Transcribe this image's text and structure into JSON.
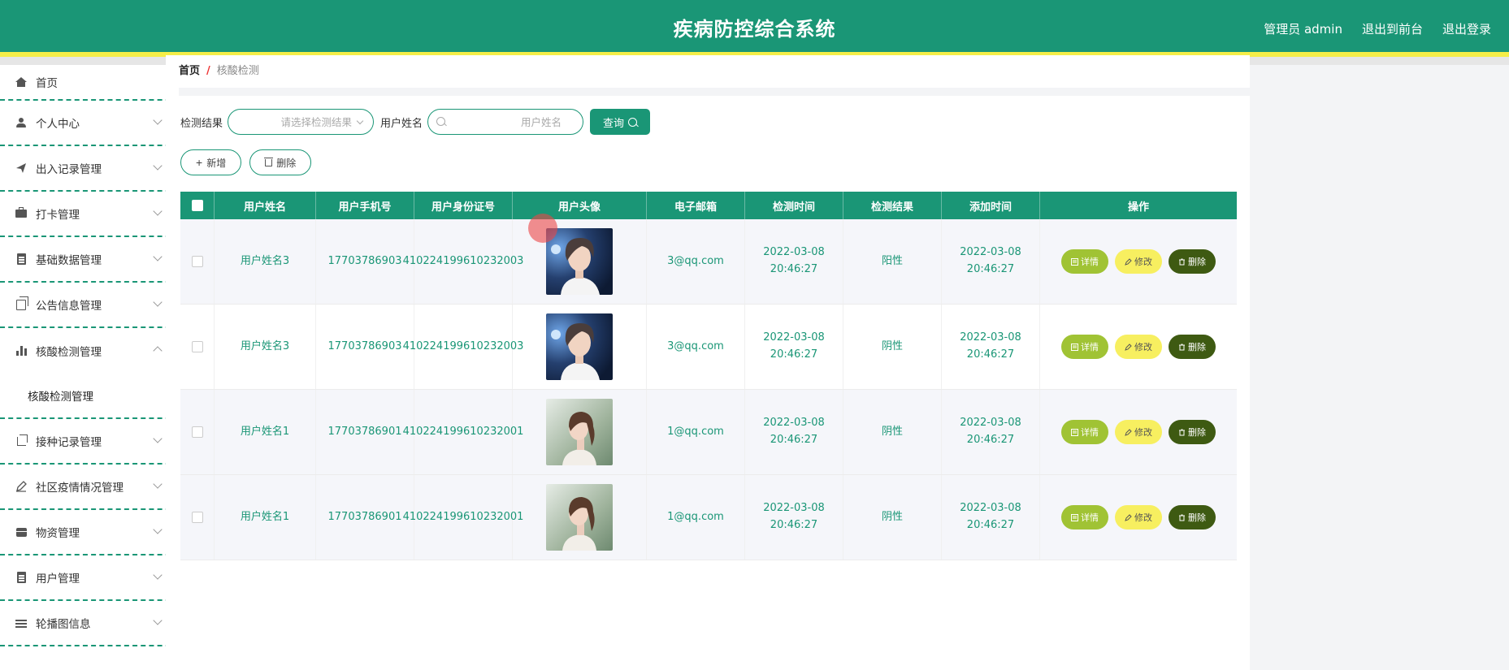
{
  "header": {
    "title": "疾病防控综合系统",
    "admin": "管理员 admin",
    "to_front": "退出到前台",
    "logout": "退出登录"
  },
  "sidebar": {
    "items": [
      {
        "label": "首页",
        "icon": "home-icon"
      },
      {
        "label": "个人中心",
        "icon": "user-icon"
      },
      {
        "label": "出入记录管理",
        "icon": "send-icon"
      },
      {
        "label": "打卡管理",
        "icon": "briefcase-icon"
      },
      {
        "label": "基础数据管理",
        "icon": "clipboard-icon"
      },
      {
        "label": "公告信息管理",
        "icon": "copy-icon"
      },
      {
        "label": "核酸检测管理",
        "icon": "bar-chart-icon",
        "sub": "核酸检测管理"
      },
      {
        "label": "接种记录管理",
        "icon": "crop-icon"
      },
      {
        "label": "社区疫情情况管理",
        "icon": "pencil-icon"
      },
      {
        "label": "物资管理",
        "icon": "box-icon"
      },
      {
        "label": "用户管理",
        "icon": "clipboard-icon"
      },
      {
        "label": "轮播图信息",
        "icon": "sliders-icon"
      }
    ]
  },
  "breadcrumb": {
    "home": "首页",
    "current": "核酸检测"
  },
  "search": {
    "result_label": "检测结果",
    "result_placeholder": "请选择检测结果",
    "name_label": "用户姓名",
    "name_placeholder": "用户姓名",
    "query_button": "查询"
  },
  "actions": {
    "add": "新增",
    "delete": "删除"
  },
  "table": {
    "columns": [
      "用户姓名",
      "用户手机号",
      "用户身份证号",
      "用户头像",
      "电子邮箱",
      "检测时间",
      "检测结果",
      "添加时间",
      "操作"
    ],
    "rows": [
      {
        "name": "用户姓名3",
        "phone": "17703786903",
        "id_card": "410224199610232003",
        "email": "3@qq.com",
        "test_time": "2022-03-08 20:46:27",
        "result": "阳性",
        "add_time": "2022-03-08 20:46:27",
        "avatar": "male"
      },
      {
        "name": "用户姓名3",
        "phone": "17703786903",
        "id_card": "410224199610232003",
        "email": "3@qq.com",
        "test_time": "2022-03-08 20:46:27",
        "result": "阴性",
        "add_time": "2022-03-08 20:46:27",
        "avatar": "male"
      },
      {
        "name": "用户姓名1",
        "phone": "17703786901",
        "id_card": "410224199610232001",
        "email": "1@qq.com",
        "test_time": "2022-03-08 20:46:27",
        "result": "阴性",
        "add_time": "2022-03-08 20:46:27",
        "avatar": "female"
      },
      {
        "name": "用户姓名1",
        "phone": "17703786901",
        "id_card": "410224199610232001",
        "email": "1@qq.com",
        "test_time": "2022-03-08 20:46:27",
        "result": "阴性",
        "add_time": "2022-03-08 20:46:27",
        "avatar": "female"
      }
    ],
    "op": {
      "detail": "详情",
      "edit": "修改",
      "delete": "删除"
    }
  },
  "colors": {
    "primary": "#1a9676",
    "accent": "#f5ee48",
    "detail": "#a0c334",
    "edit": "#f7ef60",
    "delete": "#3e5a12"
  }
}
